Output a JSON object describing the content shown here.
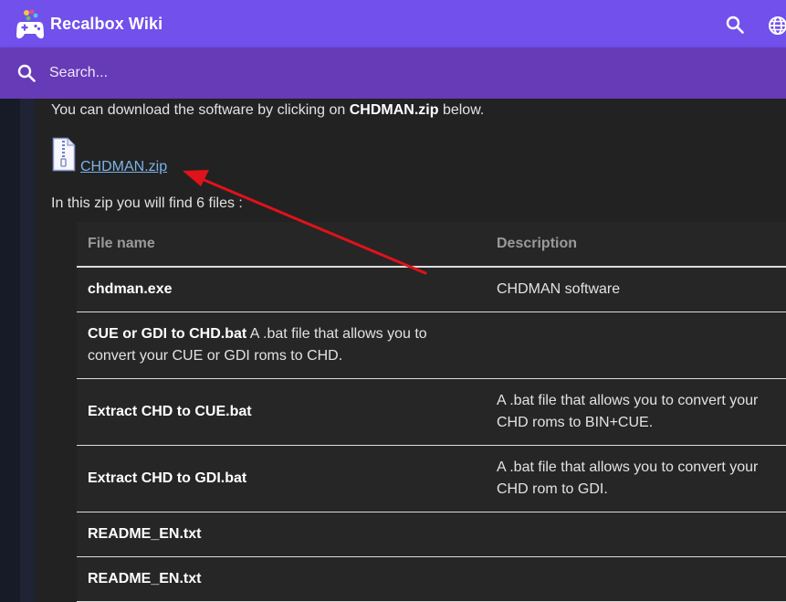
{
  "header": {
    "app_title": "Recalbox Wiki",
    "icons": [
      "gamepad-logo-icon",
      "search-icon",
      "globe-icon"
    ]
  },
  "search": {
    "placeholder": "Search..."
  },
  "content": {
    "intro_prefix": "You can download the software by clicking on ",
    "intro_bold": "CHDMAN.zip",
    "intro_suffix": " below.",
    "file_link": "CHDMAN.zip",
    "zip_description": "In this zip you will find 6 files :",
    "table": {
      "headers": [
        "File name",
        "Description"
      ],
      "rows": [
        {
          "name": "chdman.exe",
          "inline": "",
          "description": "CHDMAN software"
        },
        {
          "name": "CUE or GDI to CHD.bat",
          "inline": " A .bat file that allows you to convert your CUE or GDI roms to CHD.",
          "description": ""
        },
        {
          "name": "Extract CHD to CUE.bat",
          "inline": "",
          "description": "A .bat file that allows you to convert your CHD roms to BIN+CUE."
        },
        {
          "name": "Extract CHD to GDI.bat",
          "inline": "",
          "description": "A .bat file that allows you to convert your CHD rom to GDI."
        },
        {
          "name": "README_EN.txt",
          "inline": "",
          "description": ""
        },
        {
          "name": "README_EN.txt",
          "inline": "",
          "description": ""
        }
      ]
    }
  },
  "colors": {
    "topbar": "#7150ec",
    "searchbar": "#673ab7",
    "background": "#222222",
    "link": "#7cb3e6",
    "annotation_arrow": "#e0121a"
  }
}
